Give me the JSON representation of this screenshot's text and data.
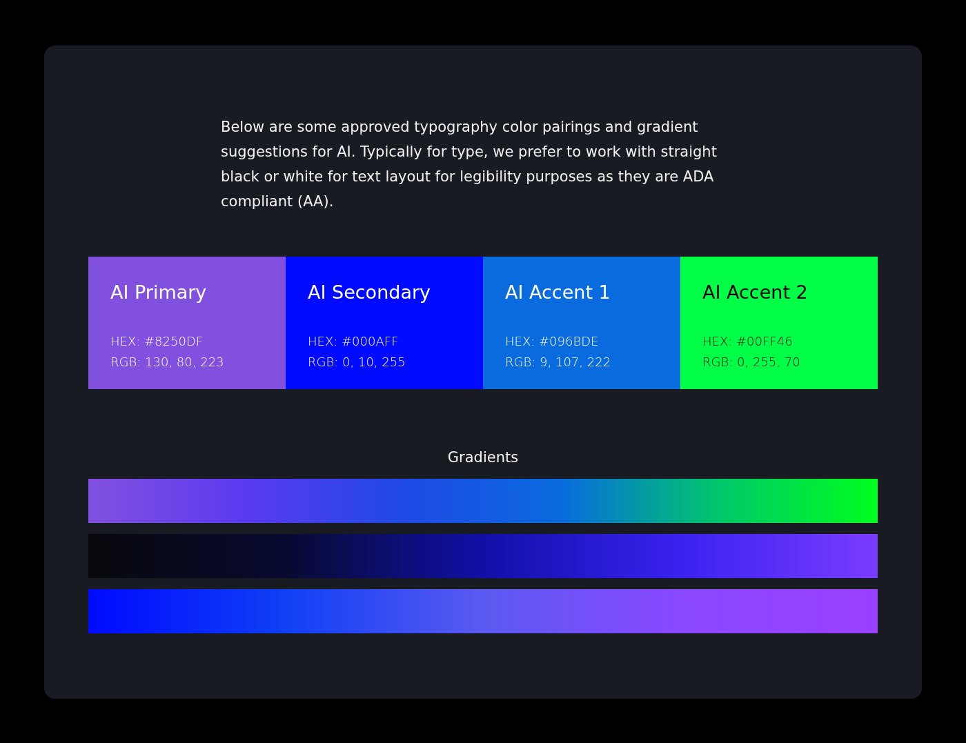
{
  "intro": "Below are some approved typography color pairings and gradient suggestions for AI. Typically for type, we prefer to work with straight black or white for text layout for legibility purposes as they are ADA compliant (AA).",
  "swatches": [
    {
      "name": "AI Primary",
      "hex": "HEX: #8250DF",
      "rgb": "RGB: 130, 80, 223",
      "color": "#8250df"
    },
    {
      "name": "AI Secondary",
      "hex": "HEX: #000AFF",
      "rgb": "RGB: 0, 10, 255",
      "color": "#000aff"
    },
    {
      "name": "AI Accent 1",
      "hex": "HEX: #096BDE",
      "rgb": "RGB: 9, 107, 222",
      "color": "#096bde"
    },
    {
      "name": "AI Accent 2",
      "hex": "HEX: #00FF46",
      "rgb": "RGB: 0, 255, 70",
      "color": "#00ff46"
    }
  ],
  "gradients_title": "Gradients",
  "gradients": [
    {
      "kind": "spectrum"
    },
    {
      "kind": "dusk"
    },
    {
      "kind": "violet"
    }
  ]
}
